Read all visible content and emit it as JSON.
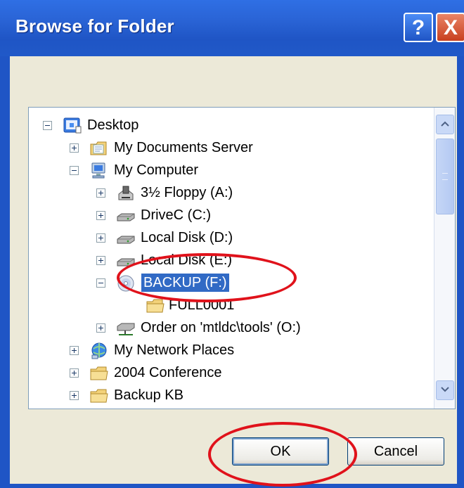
{
  "window": {
    "title": "Browse for Folder",
    "help_symbol": "?",
    "close_symbol": "X",
    "accent_color": "#1f55c5"
  },
  "tree": {
    "items": [
      {
        "label": "Desktop",
        "icon": "desktop-icon",
        "expander": "minus"
      },
      {
        "label": "My Documents Server",
        "icon": "folder-documents-icon",
        "expander": "plus"
      },
      {
        "label": "My Computer",
        "icon": "computer-icon",
        "expander": "minus"
      },
      {
        "label": "3½ Floppy (A:)",
        "icon": "floppy-drive-icon",
        "expander": "plus"
      },
      {
        "label": "DriveC (C:)",
        "icon": "hard-drive-icon",
        "expander": "plus"
      },
      {
        "label": "Local Disk (D:)",
        "icon": "hard-drive-icon",
        "expander": "plus"
      },
      {
        "label": "Local Disk (E:)",
        "icon": "hard-drive-icon",
        "expander": "plus"
      },
      {
        "label": "BACKUP (F:)",
        "icon": "cd-drive-icon",
        "expander": "minus",
        "selected": true
      },
      {
        "label": "FULL0001",
        "icon": "folder-icon",
        "expander": "none"
      },
      {
        "label": "Order on 'mtldc\\tools' (O:)",
        "icon": "network-drive-icon",
        "expander": "plus"
      },
      {
        "label": "My Network Places",
        "icon": "network-places-icon",
        "expander": "plus"
      },
      {
        "label": "2004 Conference",
        "icon": "folder-icon",
        "expander": "plus"
      },
      {
        "label": "Backup KB",
        "icon": "folder-icon",
        "expander": "plus"
      }
    ]
  },
  "buttons": {
    "ok_label": "OK",
    "cancel_label": "Cancel"
  },
  "annotations": {
    "highlight_color": "#e0121b"
  }
}
